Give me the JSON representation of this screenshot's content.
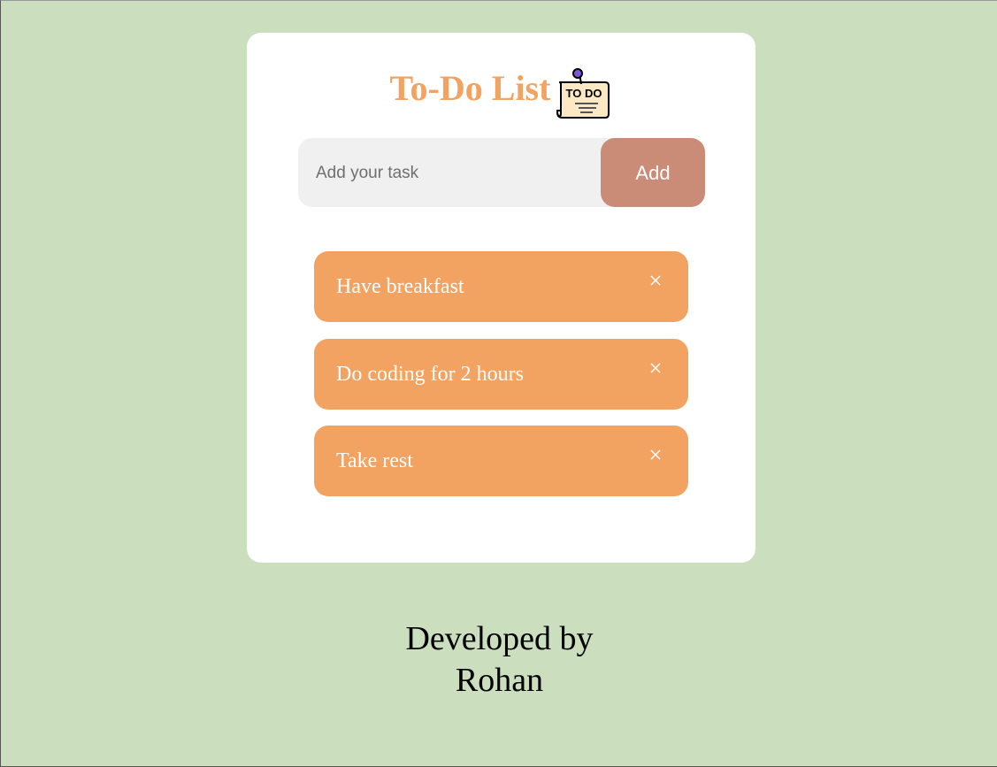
{
  "app": {
    "title": "To-Do List",
    "title_icon": "todo-note-icon",
    "colors": {
      "background": "#cbdfbf",
      "card": "#ffffff",
      "accent": "#f3a361",
      "button": "#cb8c77",
      "input_bg": "#eff0ef"
    }
  },
  "input": {
    "value": "",
    "placeholder": "Add your task"
  },
  "add_button": {
    "label": "Add"
  },
  "tasks": [
    {
      "label": "Have breakfast",
      "close_icon": "close-icon"
    },
    {
      "label": "Do coding for 2 hours",
      "close_icon": "close-icon"
    },
    {
      "label": "Take rest",
      "close_icon": "close-icon"
    }
  ],
  "footer": {
    "line1": "Developed by",
    "line2": "Rohan"
  }
}
